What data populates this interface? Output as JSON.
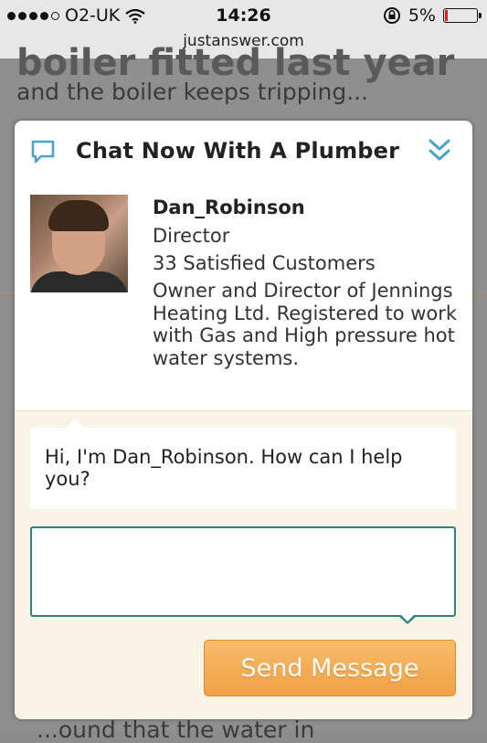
{
  "status_bar": {
    "carrier": "O2-UK",
    "signal_bars_filled": 4,
    "signal_bars_total": 5,
    "time": "14:26",
    "battery_percent": "5%",
    "battery_level": 0.05
  },
  "browser": {
    "url": "justanswer.com"
  },
  "background_page": {
    "heading_fragment": "boiler fitted last year",
    "text_line": "and the boiler keeps tripping...",
    "bottom_fragment": "...ound that the water in"
  },
  "chat_modal": {
    "title": "Chat Now With A Plumber",
    "expert": {
      "name": "Dan_Robinson",
      "role": "Director",
      "satisfied_customers": "33 Satisfied Customers",
      "bio": "Owner and Director of Jennings Heating Ltd. Registered to work with Gas and High pressure hot water systems."
    },
    "greeting": "Hi, I'm Dan_Robinson. How can I help you?",
    "message_input": {
      "value": "",
      "placeholder": ""
    },
    "send_button_label": "Send Message"
  },
  "colors": {
    "accent_teal": "#2f7f87",
    "icon_blue": "#4aa3c9",
    "button_orange": "#f0a144",
    "chat_area_bg": "#f9f4e5",
    "battery_red": "#e02020"
  }
}
